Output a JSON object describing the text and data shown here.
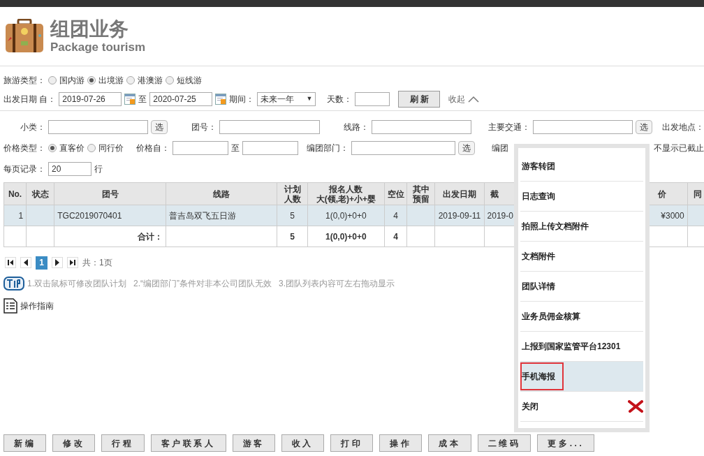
{
  "header": {
    "title": "组团业务",
    "subtitle": "Package tourism"
  },
  "tour_type": {
    "label": "旅游类型：",
    "options": [
      {
        "label": "国内游",
        "selected": false
      },
      {
        "label": "出境游",
        "selected": true
      },
      {
        "label": "港澳游",
        "selected": false
      },
      {
        "label": "短线游",
        "selected": false
      }
    ]
  },
  "date_row": {
    "label": "出发日期 自：",
    "from": "2019-07-26",
    "to_label": "至",
    "to": "2020-07-25",
    "period_label": "期间：",
    "period_value": "未来一年",
    "period_caret": "▼",
    "days_label": "天数：",
    "refresh": "刷 新",
    "collapse": "收起"
  },
  "row2": {
    "subclass_label": "小类：",
    "pick": "选",
    "group_label": "团号：",
    "route_label": "线路：",
    "traffic_label": "主要交通：",
    "traffic_pick": "选",
    "depart_label": "出发地点："
  },
  "row3": {
    "price_type_label": "价格类型：",
    "price_types": [
      {
        "label": "直客价",
        "selected": true
      },
      {
        "label": "同行价",
        "selected": false
      }
    ],
    "price_from_label": "价格自：",
    "price_to_label": "至",
    "dept_label": "编团部门：",
    "dept_pick": "选",
    "creator_label": "编团",
    "hide_expired": "不显示已截止"
  },
  "row4": {
    "label": "每页记录：",
    "value": "20",
    "unit": "行"
  },
  "table": {
    "columns": [
      [
        "No."
      ],
      [
        "状态"
      ],
      [
        "团号"
      ],
      [
        "线路"
      ],
      [
        "计划",
        "人数"
      ],
      [
        "报名人数",
        "大(领,老)+小+婴"
      ],
      [
        "空位"
      ],
      [
        "其中",
        "预留"
      ],
      [
        "出发日期"
      ],
      [
        "截"
      ],
      [
        "价"
      ],
      [
        "同"
      ]
    ],
    "rows": [
      {
        "no": "1",
        "group": "TGC2019070401",
        "route": "普吉岛双飞五日游",
        "planned": "5",
        "signed": "1(0,0)+0+0",
        "vacant": "4",
        "date": "2019-09-11",
        "column_10": "2019-0",
        "price": "¥3000",
        "selected": true
      }
    ],
    "total": {
      "label": "合计：",
      "planned": "5",
      "signed": "1(0,0)+0+0",
      "vacant": "4"
    }
  },
  "pager": {
    "pages": [
      {
        "label": "1",
        "selected": true
      }
    ],
    "summary": "共：1页"
  },
  "tips": "1.双击鼠标可修改团队计划   2.“编团部门”条件对非本公司团队无效   3.团队列表内容可左右拖动显示",
  "guide": "操作指南",
  "menu": [
    {
      "label": "游客转团",
      "selected": false,
      "kind": "item"
    },
    {
      "label": "日志查询",
      "selected": false,
      "kind": "item"
    },
    {
      "label": "拍照上传文档附件",
      "selected": false,
      "kind": "item"
    },
    {
      "label": "文档附件",
      "selected": false,
      "kind": "item"
    },
    {
      "label": "团队详情",
      "selected": false,
      "kind": "item"
    },
    {
      "label": "业务员佣金核算",
      "selected": false,
      "kind": "item"
    },
    {
      "label": "上报到国家监管平台12301",
      "selected": false,
      "kind": "item"
    },
    {
      "label": "手机海报",
      "selected": true,
      "kind": "item"
    },
    {
      "label": "关闭",
      "selected": false,
      "kind": "close"
    }
  ],
  "buttons": [
    "新编",
    "修改",
    "行程",
    "客户联系人",
    "游客",
    "收入",
    "打印",
    "操作",
    "成本",
    "二维码",
    "更多..."
  ]
}
